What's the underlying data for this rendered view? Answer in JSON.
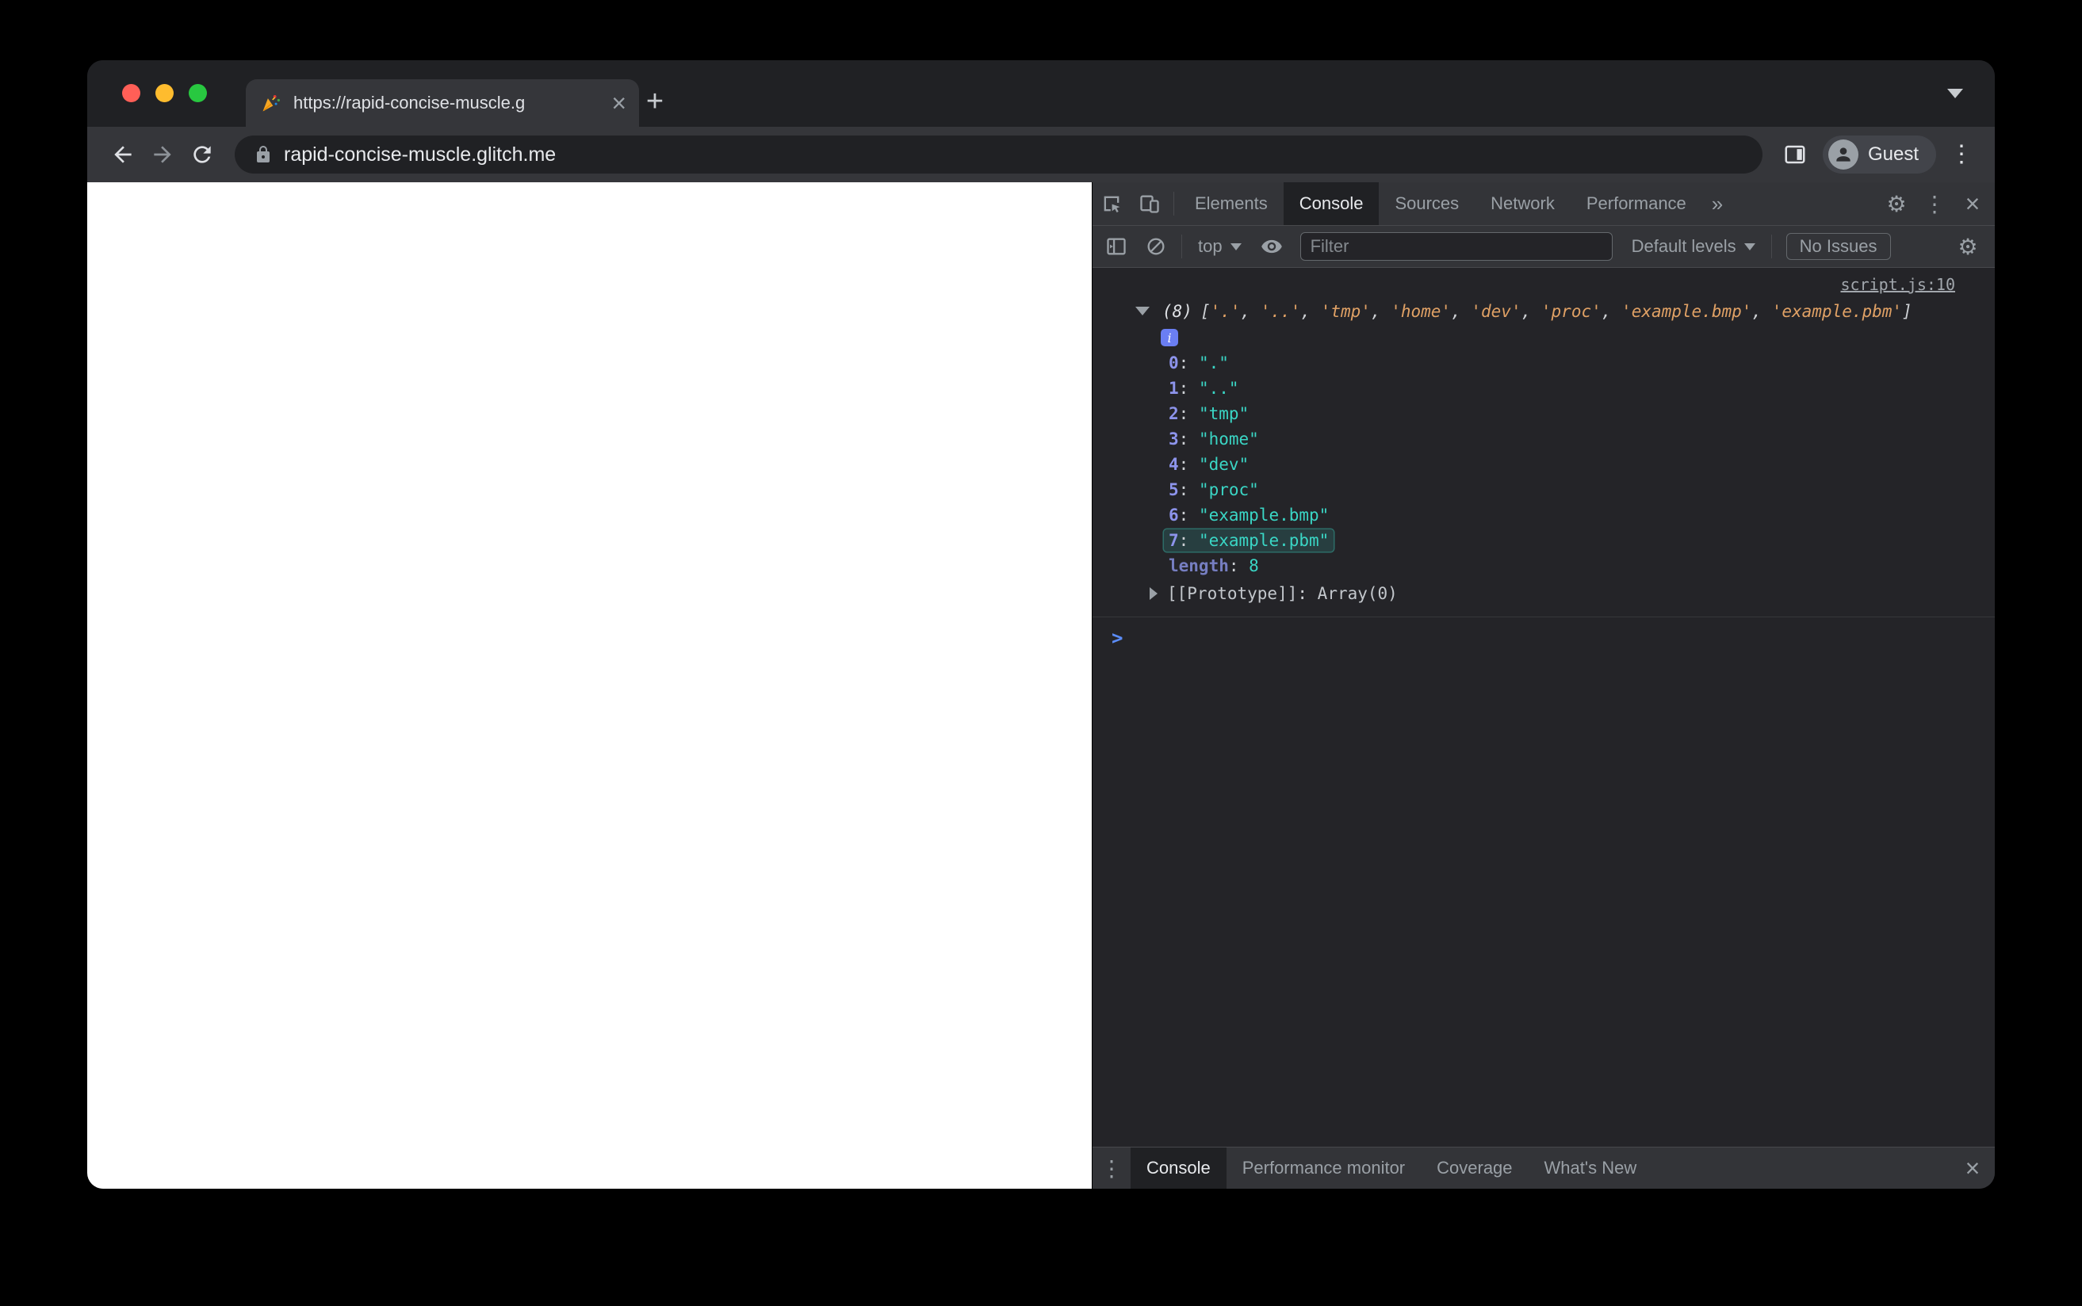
{
  "browser": {
    "tab_title": "https://rapid-concise-muscle.g",
    "url": "rapid-concise-muscle.glitch.me",
    "profile_label": "Guest"
  },
  "icons": {
    "close_glyph": "×",
    "menu_glyph": "⋮",
    "more_tabs_glyph": "»",
    "gear_glyph": "⚙",
    "new_tab_glyph": "+"
  },
  "devtools": {
    "tabs": [
      "Elements",
      "Console",
      "Sources",
      "Network",
      "Performance"
    ],
    "active_tab": "Console",
    "toolbar": {
      "context_label": "top",
      "filter_placeholder": "Filter",
      "levels_label": "Default levels",
      "issues_label": "No Issues"
    },
    "console": {
      "source_link": "script.js:10",
      "preview_prefix": "(8)",
      "preview_open": "[",
      "preview_close": "]",
      "comma_sep": ", ",
      "colon_sep": ": ",
      "preview_items": [
        "'.'",
        "'..'",
        "'tmp'",
        "'home'",
        "'dev'",
        "'proc'",
        "'example.bmp'",
        "'example.pbm'"
      ],
      "entries": [
        {
          "key": "0",
          "value": "\".\"",
          "highlight": false
        },
        {
          "key": "1",
          "value": "\"..\"",
          "highlight": false
        },
        {
          "key": "2",
          "value": "\"tmp\"",
          "highlight": false
        },
        {
          "key": "3",
          "value": "\"home\"",
          "highlight": false
        },
        {
          "key": "4",
          "value": "\"dev\"",
          "highlight": false
        },
        {
          "key": "5",
          "value": "\"proc\"",
          "highlight": false
        },
        {
          "key": "6",
          "value": "\"example.bmp\"",
          "highlight": false
        },
        {
          "key": "7",
          "value": "\"example.pbm\"",
          "highlight": true
        }
      ],
      "length_key": "length",
      "length_value": "8",
      "prototype_key": "[[Prototype]]",
      "prototype_value": "Array(0)",
      "info_glyph": "i",
      "prompt_glyph": ">"
    },
    "drawer": {
      "tabs": [
        "Console",
        "Performance monitor",
        "Coverage",
        "What's New"
      ],
      "active": "Console"
    }
  },
  "colors": {
    "traffic_red": "#ff5f57",
    "traffic_yellow": "#febc2e",
    "traffic_green": "#28c840",
    "string_preview": "#e0a165",
    "string_value": "#3ad6c5",
    "index_key": "#8d94ec",
    "prompt_blue": "#5b8cf8"
  }
}
